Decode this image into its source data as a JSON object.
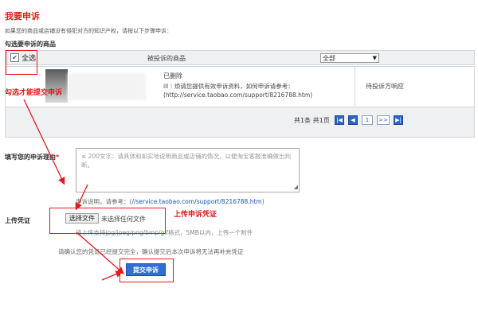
{
  "page": {
    "title": "我要申诉",
    "intro": "如果您的商品或店铺没有侵犯对方的知识产权，请按以下步骤申诉：",
    "subhead": "勾选要申诉的商品"
  },
  "table": {
    "select_all_label": "全选",
    "column_product": "被投诉的商品",
    "status_filter": "全部",
    "rows": [
      {
        "name": "已删除",
        "rule": "ill｜烦请您提供有效申诉资料，如何申诉请参考：",
        "link": "(http://service.taobao.com/support/8216788.htm)",
        "status": "待投诉方响应"
      }
    ]
  },
  "pager": {
    "info": "共1条 共1页",
    "buttons": [
      "|◀",
      "◀",
      "1",
      ">>",
      "▶|"
    ],
    "current": "1"
  },
  "form": {
    "reason_label": "填写您的申诉理由",
    "reason_required": "*",
    "reason_placeholder": "≤ 200文字：请具体和如实地说明商品或店铺的情况，以便淘宝客服准确做出判断。",
    "ref_prefix": "申诉说明，请参考：(",
    "ref_link": "//service.taobao.com/support/8216788.htm",
    "ref_suffix": ")",
    "upload_label": "上传凭证",
    "file_button": "选择文件",
    "no_file": "未选择任何文件",
    "formats": "请上传支持jpg/jpeg/png/bmp/gif格式，5MB以内，上传一个附件",
    "confirm_text": "请确认您的凭证已经提交完全，确认提交后本次申诉将无法再补充凭证",
    "submit": "提交申诉"
  },
  "annotations": {
    "check_hint": "勾选才能提交申诉",
    "upload_hint": "上传申诉凭证"
  },
  "colors": {
    "accent_red": "#e3191c",
    "link_blue": "#1a56a8",
    "submit_blue": "#2f6fd4"
  }
}
